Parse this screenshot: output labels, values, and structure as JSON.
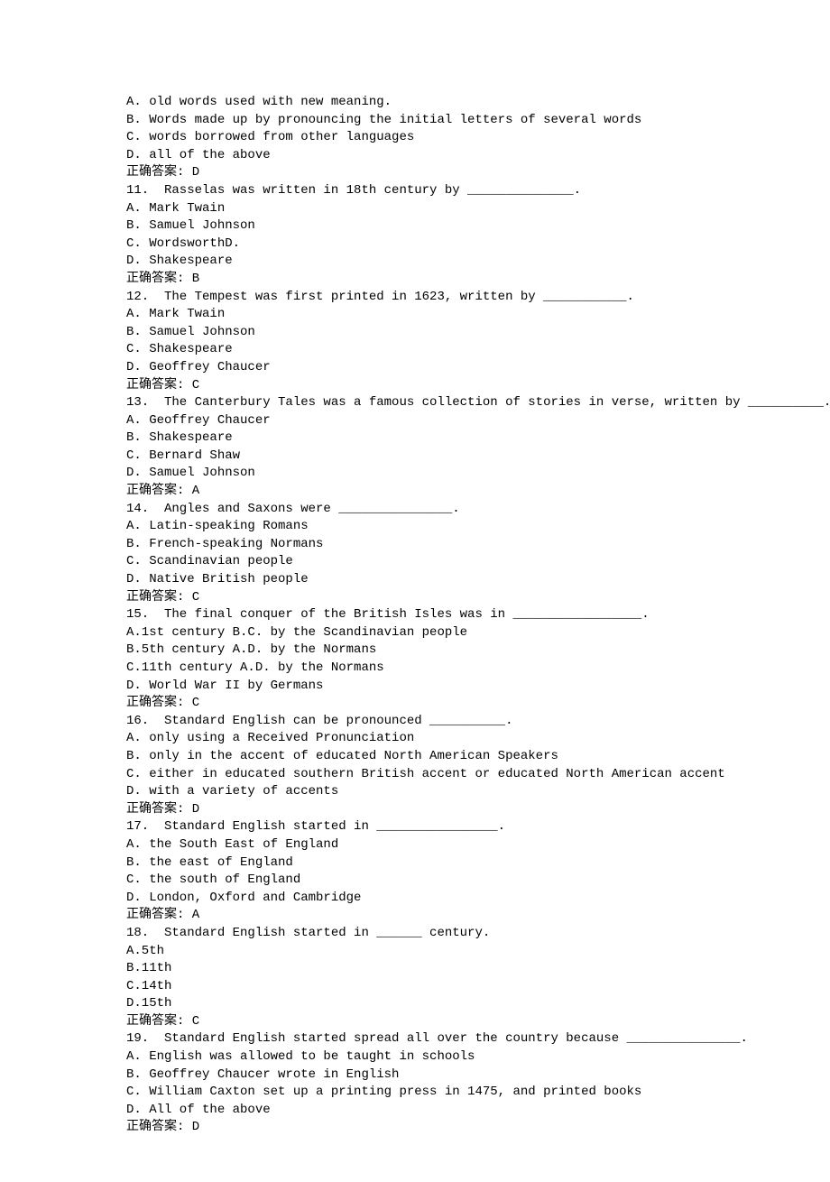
{
  "answer_label": "正确答案:",
  "items": [
    {
      "type": "option",
      "text": "A. old words used with new meaning."
    },
    {
      "type": "option",
      "text": "B. Words made up by pronouncing the initial letters of several words"
    },
    {
      "type": "option",
      "text": "C. words borrowed from other languages"
    },
    {
      "type": "option",
      "text": "D. all of the above"
    },
    {
      "type": "answer",
      "text": "D"
    },
    {
      "type": "question",
      "text": "11.  Rasselas was written in 18th century by ______________."
    },
    {
      "type": "option",
      "text": "A. Mark Twain"
    },
    {
      "type": "option",
      "text": "B. Samuel Johnson"
    },
    {
      "type": "option",
      "text": "C. WordsworthD."
    },
    {
      "type": "option",
      "text": "D. Shakespeare"
    },
    {
      "type": "answer",
      "text": "B"
    },
    {
      "type": "question",
      "text": "12.  The Tempest was first printed in 1623, written by ___________."
    },
    {
      "type": "option",
      "text": "A. Mark Twain"
    },
    {
      "type": "option",
      "text": "B. Samuel Johnson"
    },
    {
      "type": "option",
      "text": "C. Shakespeare"
    },
    {
      "type": "option",
      "text": "D. Geoffrey Chaucer"
    },
    {
      "type": "answer",
      "text": "C"
    },
    {
      "type": "question",
      "text": "13.  The Canterbury Tales was a famous collection of stories in verse, written by __________."
    },
    {
      "type": "option",
      "text": "A. Geoffrey Chaucer"
    },
    {
      "type": "option",
      "text": "B. Shakespeare"
    },
    {
      "type": "option",
      "text": "C. Bernard Shaw"
    },
    {
      "type": "option",
      "text": "D. Samuel Johnson"
    },
    {
      "type": "answer",
      "text": "A"
    },
    {
      "type": "question",
      "text": "14.  Angles and Saxons were _______________."
    },
    {
      "type": "option",
      "text": "A. Latin-speaking Romans"
    },
    {
      "type": "option",
      "text": "B. French-speaking Normans"
    },
    {
      "type": "option",
      "text": "C. Scandinavian people"
    },
    {
      "type": "option",
      "text": "D. Native British people"
    },
    {
      "type": "answer",
      "text": "C"
    },
    {
      "type": "question",
      "text": "15.  The final conquer of the British Isles was in _________________."
    },
    {
      "type": "option",
      "text": "A.1st century B.C. by the Scandinavian people"
    },
    {
      "type": "option",
      "text": "B.5th century A.D. by the Normans"
    },
    {
      "type": "option",
      "text": "C.11th century A.D. by the Normans"
    },
    {
      "type": "option",
      "text": "D. World War II by Germans"
    },
    {
      "type": "answer",
      "text": "C"
    },
    {
      "type": "question",
      "text": "16.  Standard English can be pronounced __________."
    },
    {
      "type": "option",
      "text": "A. only using a Received Pronunciation"
    },
    {
      "type": "option",
      "text": "B. only in the accent of educated North American Speakers"
    },
    {
      "type": "option",
      "text": "C. either in educated southern British accent or educated North American accent"
    },
    {
      "type": "option",
      "text": "D. with a variety of accents"
    },
    {
      "type": "answer",
      "text": "D"
    },
    {
      "type": "question",
      "text": "17.  Standard English started in ________________."
    },
    {
      "type": "option",
      "text": "A. the South East of England"
    },
    {
      "type": "option",
      "text": "B. the east of England"
    },
    {
      "type": "option",
      "text": "C. the south of England"
    },
    {
      "type": "option",
      "text": "D. London, Oxford and Cambridge"
    },
    {
      "type": "answer",
      "text": "A"
    },
    {
      "type": "question",
      "text": "18.  Standard English started in ______ century."
    },
    {
      "type": "option",
      "text": "A.5th"
    },
    {
      "type": "option",
      "text": "B.11th"
    },
    {
      "type": "option",
      "text": "C.14th"
    },
    {
      "type": "option",
      "text": "D.15th"
    },
    {
      "type": "answer",
      "text": "C"
    },
    {
      "type": "question",
      "text": "19.  Standard English started spread all over the country because _______________."
    },
    {
      "type": "option",
      "text": "A. English was allowed to be taught in schools"
    },
    {
      "type": "option",
      "text": "B. Geoffrey Chaucer wrote in English"
    },
    {
      "type": "option",
      "text": "C. William Caxton set up a printing press in 1475, and printed books"
    },
    {
      "type": "option",
      "text": "D. All of the above"
    },
    {
      "type": "answer",
      "text": "D"
    }
  ]
}
